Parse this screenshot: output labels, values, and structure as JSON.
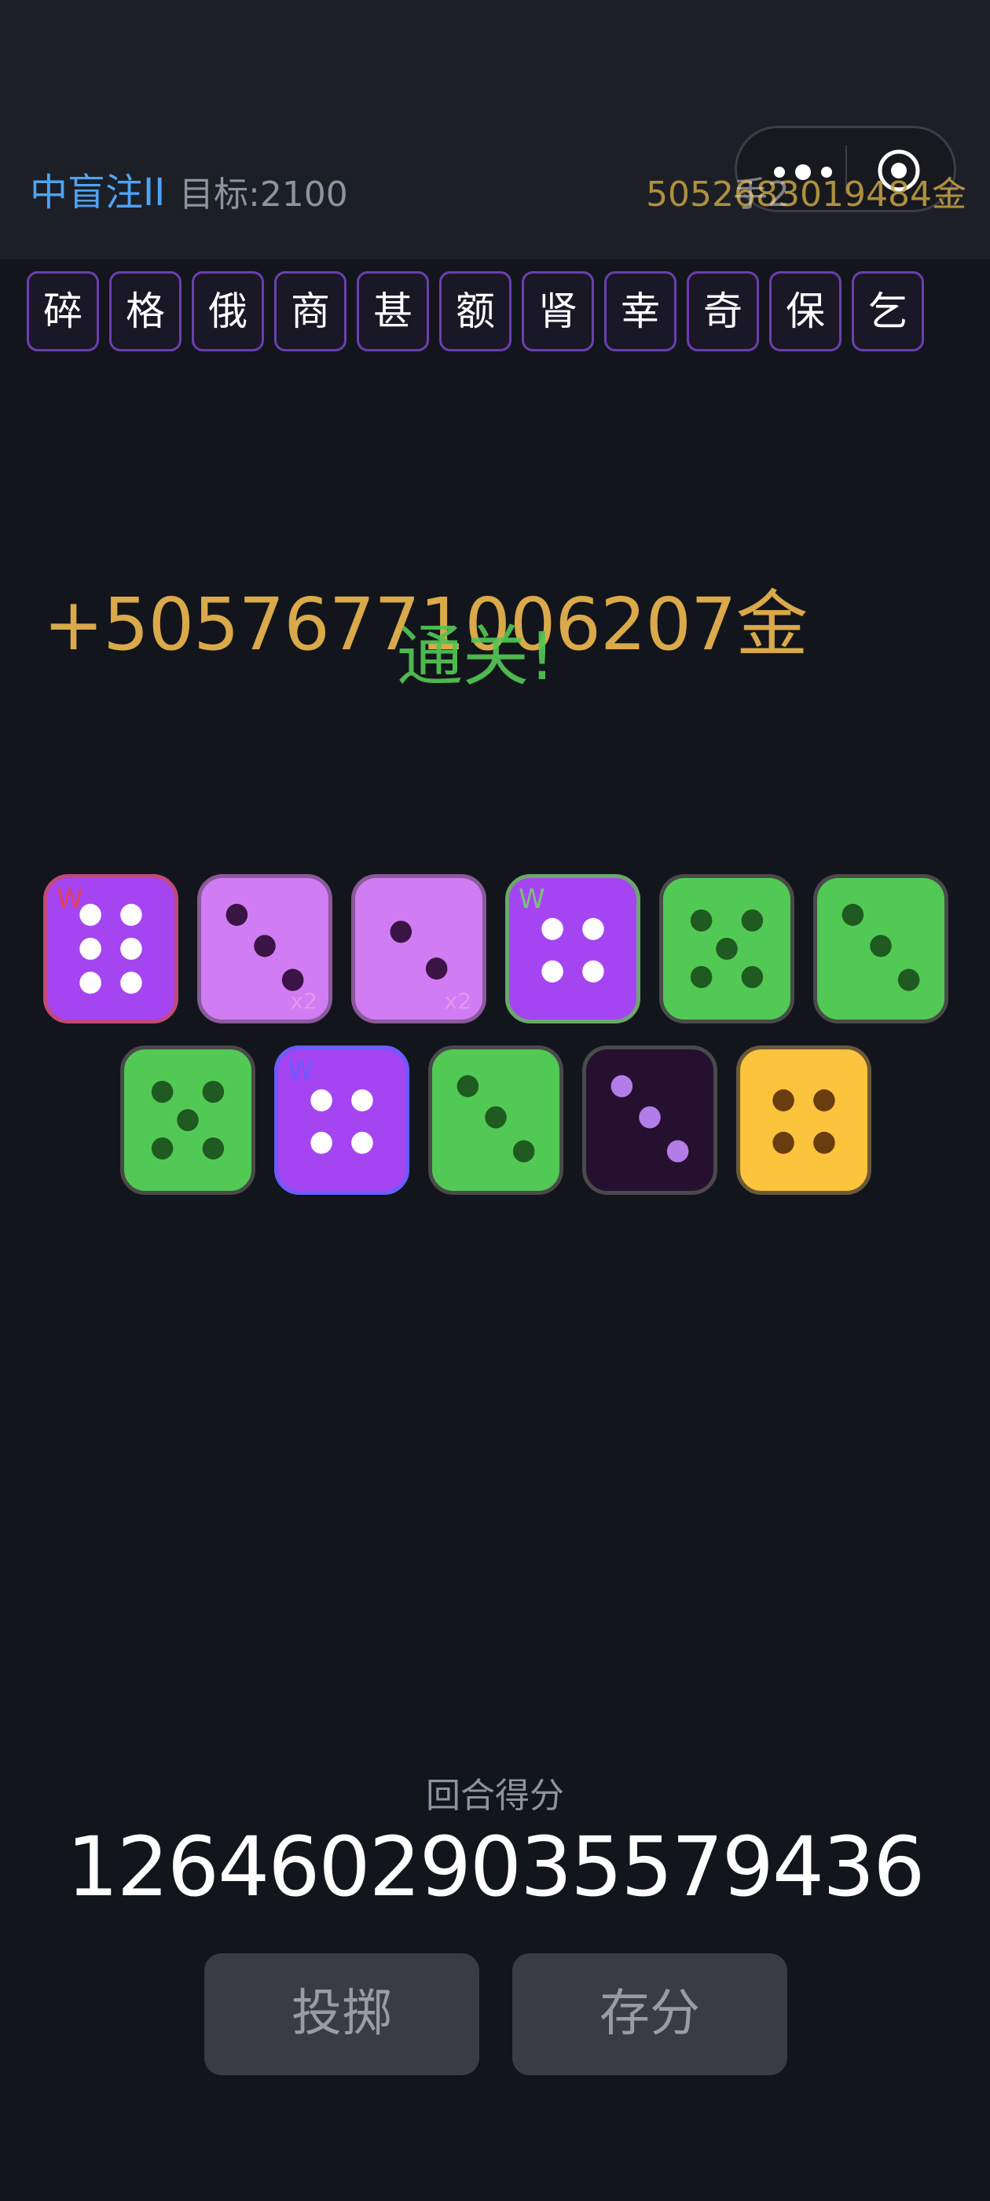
{
  "header": {
    "level_name": "中盲注II",
    "target": "目标:2100",
    "gold_total": "5052683019484金",
    "overlay_text": "手2"
  },
  "tiles": [
    "碎",
    "格",
    "俄",
    "商",
    "甚",
    "额",
    "肾",
    "幸",
    "奇",
    "保",
    "乞"
  ],
  "result": {
    "gold_gain": "+50576771006207金",
    "clear_text": "通关!"
  },
  "dice": [
    {
      "face": 6,
      "color": "purple",
      "tag_w": "W"
    },
    {
      "face": 3,
      "color": "light-purple",
      "tag_x": "x2"
    },
    {
      "face": 2,
      "color": "light-purple",
      "tag_x": "x2"
    },
    {
      "face": 4,
      "color": "purple",
      "tag_w": "W"
    },
    {
      "face": 5,
      "color": "green"
    },
    {
      "face": 3,
      "color": "green"
    },
    {
      "face": 5,
      "color": "green"
    },
    {
      "face": 4,
      "color": "purple",
      "tag_w": "W"
    },
    {
      "face": 3,
      "color": "green"
    },
    {
      "face": 3,
      "color": "dark-purple"
    },
    {
      "face": 4,
      "color": "yellow"
    }
  ],
  "round": {
    "label": "回合得分",
    "score": "1264602903557943 6"
  },
  "buttons": {
    "roll": "投掷",
    "bank": "存分"
  },
  "colors": {
    "purple": "#a545f2",
    "light-purple": "#d07cf3",
    "green": "#52c954",
    "dark-purple": "#25102f",
    "yellow": "#fcc33c"
  }
}
